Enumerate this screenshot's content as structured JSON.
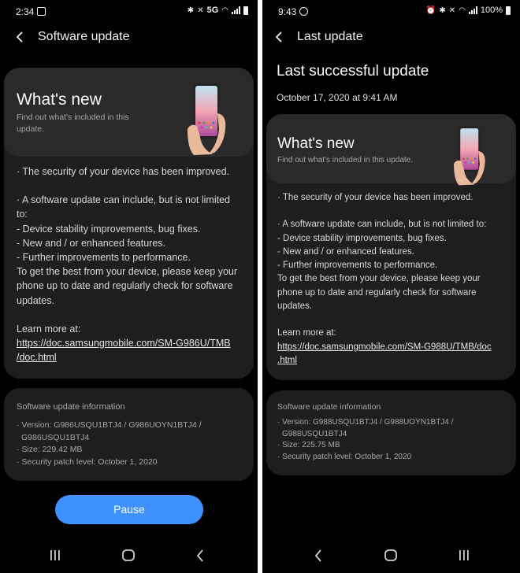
{
  "left": {
    "status": {
      "time": "2:34",
      "network": "5G"
    },
    "appbar": {
      "title": "Software update"
    },
    "whats_new": {
      "title": "What's new",
      "subtitle_line1": "Find out what's included in this",
      "subtitle_line2": "update."
    },
    "body": {
      "security": "· The security of your device has been improved.",
      "can_include_1": "· A software update can include, but is not limited",
      "can_include_2": "to:",
      "item1": " - Device stability improvements, bug fixes.",
      "item2": " - New and / or enhanced features.",
      "item3": " - Further improvements to performance.",
      "best1": "To get the best from your device, please keep your",
      "best2": "phone up to date and regularly check for software",
      "best3": "updates.",
      "learn_more": "Learn more at:",
      "link1": "https://doc.samsungmobile.com/SM-G986U/TMB",
      "link2": "/doc.html"
    },
    "info": {
      "title": "Software update information",
      "version1": "· Version: G986USQU1BTJ4 / G986UOYN1BTJ4 /",
      "version2": "  G986USQU1BTJ4",
      "size": "· Size: 229.42 MB",
      "patch": "· Security patch level: October 1, 2020"
    },
    "pause_label": "Pause"
  },
  "right": {
    "status": {
      "time": "9:43",
      "battery": "100%"
    },
    "appbar": {
      "title": "Last update"
    },
    "heading": "Last successful update",
    "date": "October 17, 2020 at 9:41 AM",
    "whats_new": {
      "title": "What's new",
      "subtitle": "Find out what's included in this update."
    },
    "body": {
      "security": "· The security of your device has been improved.",
      "can_include": "· A software update can include, but is not limited to:",
      "item1": " - Device stability improvements, bug fixes.",
      "item2": " - New and / or enhanced features.",
      "item3": " - Further improvements to performance.",
      "best1": "To get the best from your device, please keep your",
      "best2": "phone up to date and regularly check for software",
      "best3": "updates.",
      "learn_more": "Learn more at:",
      "link1": "https://doc.samsungmobile.com/SM-G988U/TMB/doc",
      "link2": ".html"
    },
    "info": {
      "title": "Software update information",
      "version1": "· Version: G988USQU1BTJ4 / G988UOYN1BTJ4 /",
      "version2": "  G988USQU1BTJ4",
      "size": "· Size: 225.75 MB",
      "patch": "· Security patch level: October 1, 2020"
    }
  },
  "colors": {
    "accent": "#3e91ff",
    "background": "#000000",
    "card": "#1e1e1e",
    "card_header": "#2a2a2a"
  },
  "icons": [
    "back-icon",
    "bluetooth-icon",
    "wifi-icon",
    "signal-icon",
    "battery-icon",
    "alarm-icon",
    "recents-icon",
    "home-icon",
    "nav-back-icon"
  ]
}
